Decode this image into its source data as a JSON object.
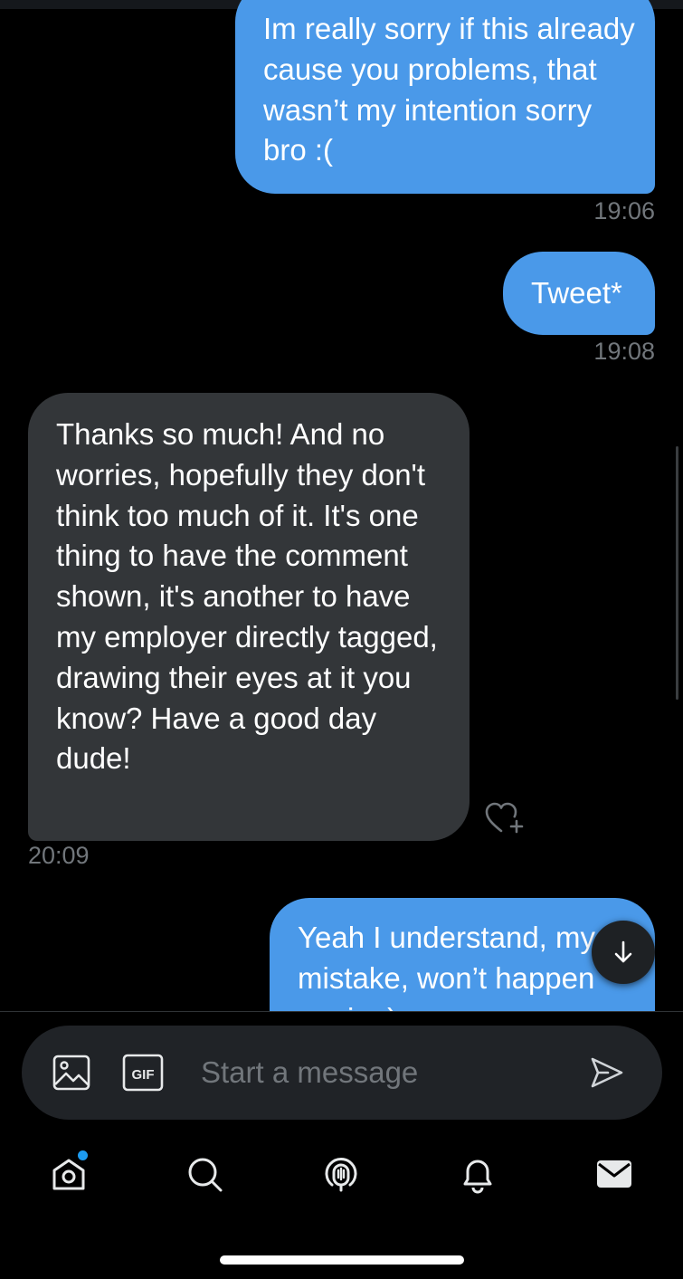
{
  "messages": [
    {
      "direction": "outgoing",
      "text": "Im really sorry if this already cause you problems, that wasn’t my intention sorry bro :(",
      "time": "19:06"
    },
    {
      "direction": "outgoing",
      "text": "Tweet*",
      "time": "19:08"
    },
    {
      "direction": "incoming",
      "text": "Thanks so much! And no worries, hopefully they don't think too much of it. It's one thing to have the comment shown, it's another to have my employer directly tagged, drawing their eyes at it you know? Have a good day dude!",
      "time": "20:09"
    },
    {
      "direction": "outgoing",
      "text": "Yeah I understand, my mistake, won’t happen again :)",
      "time": ""
    }
  ],
  "composer": {
    "placeholder": "Start a message",
    "gif_label": "GIF",
    "media_icon": "image-icon",
    "send_icon": "send-icon"
  },
  "tabbar": {
    "items": [
      {
        "icon": "home-icon",
        "has_badge": true
      },
      {
        "icon": "search-icon"
      },
      {
        "icon": "spaces-icon"
      },
      {
        "icon": "bell-icon"
      },
      {
        "icon": "envelope-icon"
      }
    ]
  },
  "colors": {
    "background": "#000000",
    "outgoing_bubble": "#4a99e9",
    "incoming_bubble": "#333639",
    "timestamp": "#71767b",
    "accent": "#1d9bf0",
    "composer_bg": "#202327"
  }
}
